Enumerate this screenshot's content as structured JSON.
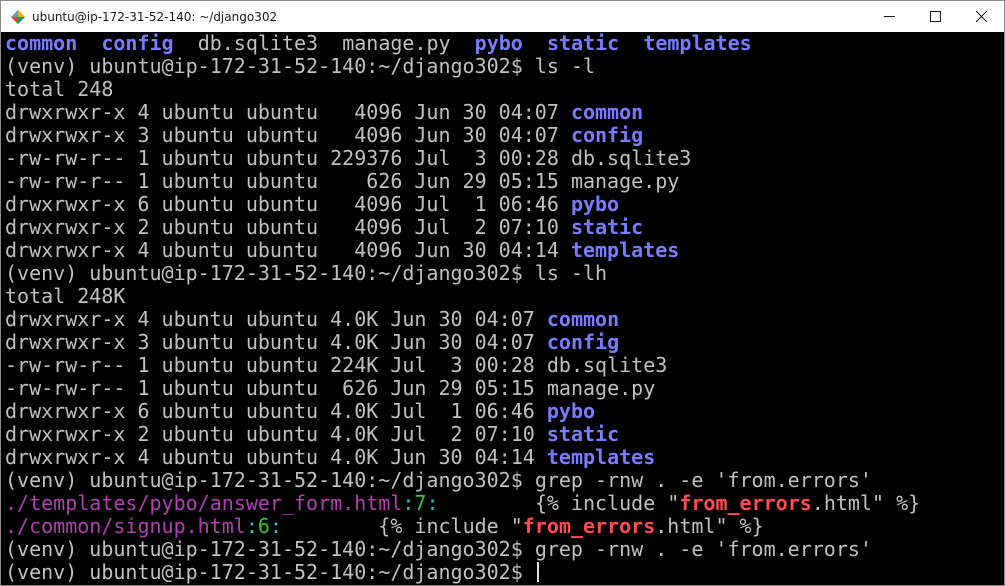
{
  "window": {
    "title": "ubuntu@ip-172-31-52-140: ~/django302",
    "icons": {
      "app": "terminal-app-icon",
      "minimize": "minimize-icon",
      "maximize": "maximize-icon",
      "close": "close-icon"
    }
  },
  "terminal": {
    "prompt": "(venv) ubuntu@ip-172-31-52-140:~/django302$ ",
    "ls_output": {
      "common": "common",
      "config": "config",
      "db": "db.sqlite3",
      "manage": "manage.py",
      "pybo": "pybo",
      "static": "static",
      "templates": "templates"
    },
    "cmd_ls_l": "ls -l",
    "total_l": "total 248",
    "rows_l": [
      {
        "prefix": "drwxrwxr-x 4 ubuntu ubuntu   4096 Jun 30 04:07 ",
        "name": "common",
        "dir": true
      },
      {
        "prefix": "drwxrwxr-x 3 ubuntu ubuntu   4096 Jun 30 04:07 ",
        "name": "config",
        "dir": true
      },
      {
        "prefix": "-rw-rw-r-- 1 ubuntu ubuntu 229376 Jul  3 00:28 ",
        "name": "db.sqlite3",
        "dir": false
      },
      {
        "prefix": "-rw-rw-r-- 1 ubuntu ubuntu    626 Jun 29 05:15 ",
        "name": "manage.py",
        "dir": false
      },
      {
        "prefix": "drwxrwxr-x 6 ubuntu ubuntu   4096 Jul  1 06:46 ",
        "name": "pybo",
        "dir": true
      },
      {
        "prefix": "drwxrwxr-x 2 ubuntu ubuntu   4096 Jul  2 07:10 ",
        "name": "static",
        "dir": true
      },
      {
        "prefix": "drwxrwxr-x 4 ubuntu ubuntu   4096 Jun 30 04:14 ",
        "name": "templates",
        "dir": true
      }
    ],
    "cmd_ls_lh": "ls -lh",
    "total_lh": "total 248K",
    "rows_lh": [
      {
        "prefix": "drwxrwxr-x 4 ubuntu ubuntu 4.0K Jun 30 04:07 ",
        "name": "common",
        "dir": true
      },
      {
        "prefix": "drwxrwxr-x 3 ubuntu ubuntu 4.0K Jun 30 04:07 ",
        "name": "config",
        "dir": true
      },
      {
        "prefix": "-rw-rw-r-- 1 ubuntu ubuntu 224K Jul  3 00:28 ",
        "name": "db.sqlite3",
        "dir": false
      },
      {
        "prefix": "-rw-rw-r-- 1 ubuntu ubuntu  626 Jun 29 05:15 ",
        "name": "manage.py",
        "dir": false
      },
      {
        "prefix": "drwxrwxr-x 6 ubuntu ubuntu 4.0K Jul  1 06:46 ",
        "name": "pybo",
        "dir": true
      },
      {
        "prefix": "drwxrwxr-x 2 ubuntu ubuntu 4.0K Jul  2 07:10 ",
        "name": "static",
        "dir": true
      },
      {
        "prefix": "drwxrwxr-x 4 ubuntu ubuntu 4.0K Jun 30 04:14 ",
        "name": "templates",
        "dir": true
      }
    ],
    "cmd_grep": "grep -rnw . -e 'from.errors'",
    "grep_results": [
      {
        "path": "./templates/pybo/answer_form.html",
        "line": "7",
        "gap": "        ",
        "before": "{% include \"",
        "match": "from_errors",
        "after": ".html\" %}"
      },
      {
        "path": "./common/signup.html",
        "line": "6",
        "gap": "        ",
        "before": "{% include \"",
        "match": "from_errors",
        "after": ".html\" %}"
      }
    ],
    "colors": {
      "dir": "#7b7bff",
      "path": "#b040b0",
      "line_number": "#38c238",
      "separator": "#2ec2c2",
      "match": "#ff4d4d",
      "text": "#c0c0c0",
      "background": "#000000"
    }
  }
}
